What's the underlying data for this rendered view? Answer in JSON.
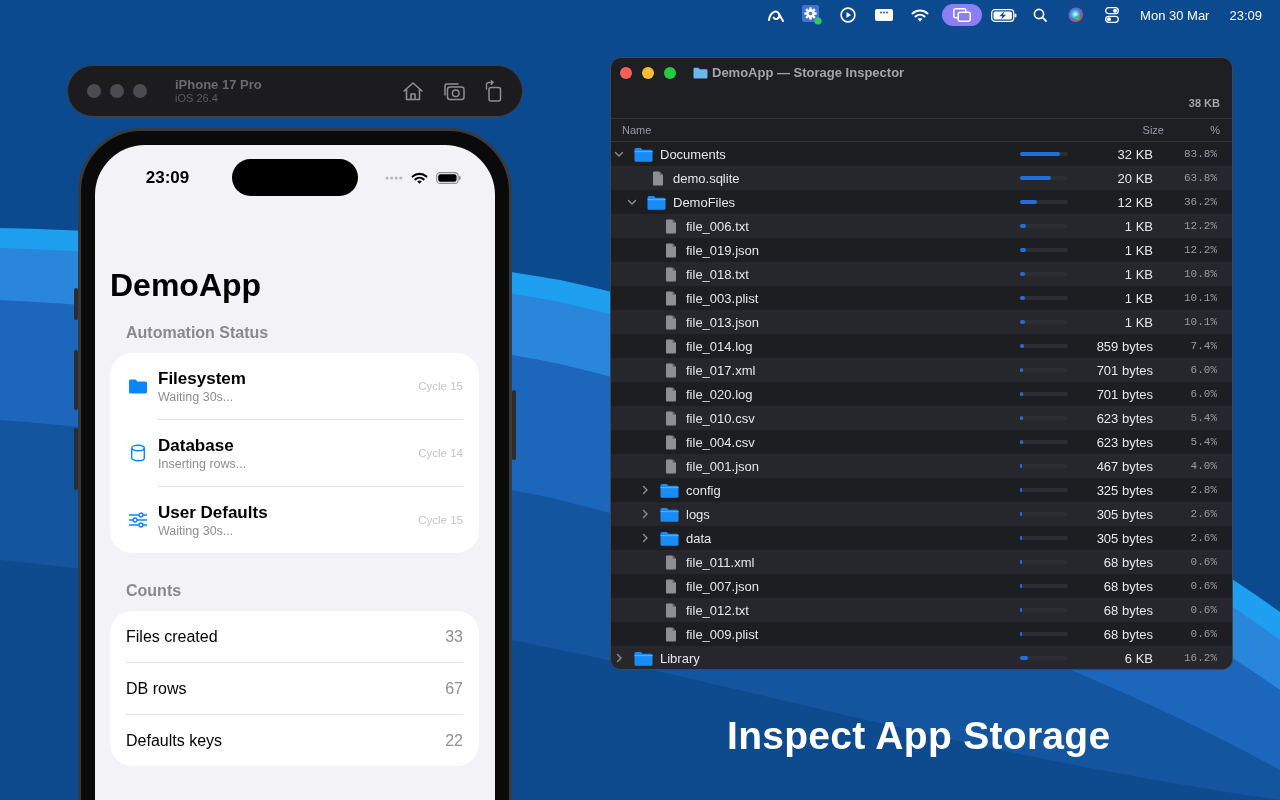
{
  "menu_bar": {
    "status_icons": [
      {
        "kind": "swoosh",
        "active": false
      },
      {
        "kind": "gear",
        "active": false
      },
      {
        "kind": "play",
        "active": false
      },
      {
        "kind": "window",
        "active": false
      },
      {
        "kind": "wifi",
        "active": false
      },
      {
        "kind": "mirroring",
        "active": true
      },
      {
        "kind": "battery",
        "active": false
      },
      {
        "kind": "search",
        "active": false
      },
      {
        "kind": "siri",
        "active": false
      },
      {
        "kind": "toggles",
        "active": false
      }
    ],
    "date": "Mon 30 Mar",
    "time": "23:09"
  },
  "simulator_toolbar": {
    "device": "iPhone 17 Pro",
    "os": "iOS 26.4"
  },
  "phone": {
    "status_bar": {
      "time": "23:09"
    },
    "title": "DemoApp",
    "sections": [
      {
        "kind": "status",
        "header": "Automation Status",
        "rows": [
          {
            "kind": "folder",
            "title": "Filesystem",
            "subtitle": "Waiting 30s...",
            "cycle": "Cycle 15"
          },
          {
            "kind": "database",
            "title": "Database",
            "subtitle": "Inserting rows...",
            "cycle": "Cycle 14"
          },
          {
            "kind": "sliders",
            "title": "User Defaults",
            "subtitle": "Waiting 30s...",
            "cycle": "Cycle 15"
          }
        ]
      },
      {
        "kind": "counts",
        "header": "Counts",
        "rows": [
          {
            "label": "Files created",
            "value": "33"
          },
          {
            "label": "DB rows",
            "value": "67"
          },
          {
            "label": "Defaults keys",
            "value": "22"
          }
        ]
      }
    ]
  },
  "inspector": {
    "title": "DemoApp — Storage Inspector",
    "total": "38 KB",
    "columns": [
      "Name",
      "Size",
      "%"
    ],
    "items": [
      {
        "kind": "folder",
        "name": "Documents",
        "expanded": true,
        "size": "32 KB",
        "percent": "83.8%",
        "level": 0.838,
        "children": [
          {
            "kind": "file",
            "name": "demo.sqlite",
            "size": "20 KB",
            "percent": "63.8%",
            "level": 0.638
          },
          {
            "kind": "folder",
            "name": "DemoFiles",
            "expanded": true,
            "size": "12 KB",
            "percent": "36.2%",
            "level": 0.362,
            "children": [
              {
                "kind": "file",
                "name": "file_006.txt",
                "size": "1 KB",
                "percent": "12.2%",
                "level": 0.122
              },
              {
                "kind": "file",
                "name": "file_019.json",
                "size": "1 KB",
                "percent": "12.2%",
                "level": 0.122
              },
              {
                "kind": "file",
                "name": "file_018.txt",
                "size": "1 KB",
                "percent": "10.8%",
                "level": 0.108
              },
              {
                "kind": "file",
                "name": "file_003.plist",
                "size": "1 KB",
                "percent": "10.1%",
                "level": 0.101
              },
              {
                "kind": "file",
                "name": "file_013.json",
                "size": "1 KB",
                "percent": "10.1%",
                "level": 0.101
              },
              {
                "kind": "file",
                "name": "file_014.log",
                "size": "859 bytes",
                "percent": "7.4%",
                "level": 0.074
              },
              {
                "kind": "file",
                "name": "file_017.xml",
                "size": "701 bytes",
                "percent": "6.0%",
                "level": 0.06
              },
              {
                "kind": "file",
                "name": "file_020.log",
                "size": "701 bytes",
                "percent": "6.0%",
                "level": 0.06
              },
              {
                "kind": "file",
                "name": "file_010.csv",
                "size": "623 bytes",
                "percent": "5.4%",
                "level": 0.054
              },
              {
                "kind": "file",
                "name": "file_004.csv",
                "size": "623 bytes",
                "percent": "5.4%",
                "level": 0.054
              },
              {
                "kind": "file",
                "name": "file_001.json",
                "size": "467 bytes",
                "percent": "4.0%",
                "level": 0.04
              },
              {
                "kind": "folder",
                "name": "config",
                "expanded": false,
                "size": "325 bytes",
                "percent": "2.8%",
                "level": 0.028
              },
              {
                "kind": "folder",
                "name": "logs",
                "expanded": false,
                "size": "305 bytes",
                "percent": "2.6%",
                "level": 0.026
              },
              {
                "kind": "folder",
                "name": "data",
                "expanded": false,
                "size": "305 bytes",
                "percent": "2.6%",
                "level": 0.026
              },
              {
                "kind": "file",
                "name": "file_011.xml",
                "size": "68 bytes",
                "percent": "0.6%",
                "level": 0.006
              },
              {
                "kind": "file",
                "name": "file_007.json",
                "size": "68 bytes",
                "percent": "0.6%",
                "level": 0.006
              },
              {
                "kind": "file",
                "name": "file_012.txt",
                "size": "68 bytes",
                "percent": "0.6%",
                "level": 0.006
              },
              {
                "kind": "file",
                "name": "file_009.plist",
                "size": "68 bytes",
                "percent": "0.6%",
                "level": 0.006
              }
            ]
          }
        ]
      },
      {
        "kind": "folder",
        "name": "Library",
        "expanded": false,
        "size": "6 KB",
        "percent": "16.2%",
        "level": 0.162
      }
    ]
  },
  "caption": "Inspect App Storage"
}
